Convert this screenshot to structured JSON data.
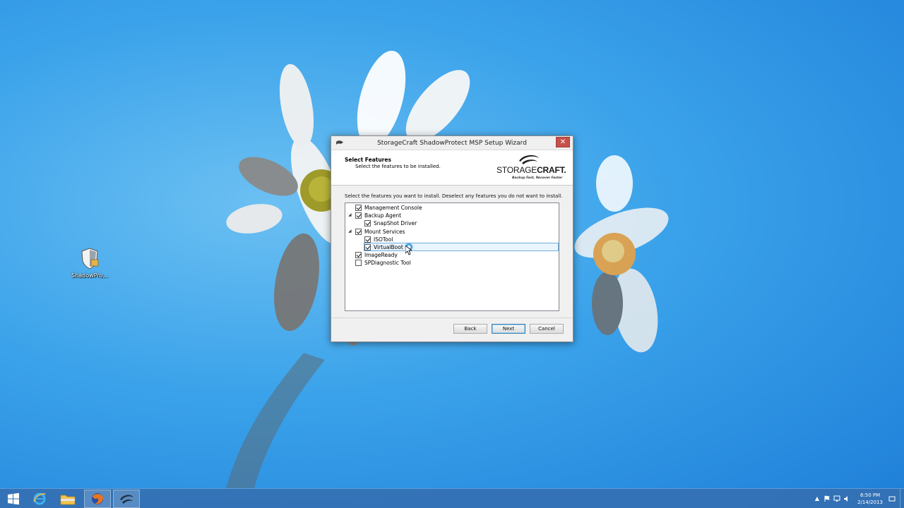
{
  "desktop": {
    "icons": [
      {
        "label": "ShadowPro...",
        "icon": "shadowprotect-installer-icon"
      }
    ]
  },
  "dialog": {
    "title": "StorageCraft ShadowProtect MSP Setup Wizard",
    "close_glyph": "✕",
    "header": {
      "title": "Select Features",
      "subtitle": "Select the features to be installed.",
      "logo_word_light": "STORAGE",
      "logo_word_bold": "CRAFT.",
      "logo_tagline": "Backup Fast, Recover Faster"
    },
    "instruction": "Select the features you want to install. Deselect any features you do not want to install.",
    "features": [
      {
        "label": "Management Console",
        "checked": true,
        "level": 0,
        "expander": ""
      },
      {
        "label": "Backup Agent",
        "checked": true,
        "level": 0,
        "expander": "◢"
      },
      {
        "label": "SnapShot Driver",
        "checked": true,
        "level": 1,
        "expander": ""
      },
      {
        "label": "Mount Services",
        "checked": true,
        "level": 0,
        "expander": "◢"
      },
      {
        "label": "ISOTool",
        "checked": true,
        "level": 1,
        "expander": ""
      },
      {
        "label": "VirtualBoot",
        "checked": true,
        "level": 1,
        "expander": "",
        "selected": true
      },
      {
        "label": "ImageReady",
        "checked": true,
        "level": 0,
        "expander": ""
      },
      {
        "label": "SPDiagnostic Tool",
        "checked": false,
        "level": 0,
        "expander": ""
      }
    ],
    "buttons": {
      "back": "Back",
      "next": "Next",
      "cancel": "Cancel"
    }
  },
  "taskbar": {
    "items": [
      "start-icon",
      "internet-explorer-icon",
      "file-explorer-icon",
      "firefox-icon",
      "storagecraft-setup-icon"
    ],
    "clock": {
      "time": "6:50 PM",
      "date": "2/14/2013"
    },
    "tray_chevron": "▲"
  }
}
